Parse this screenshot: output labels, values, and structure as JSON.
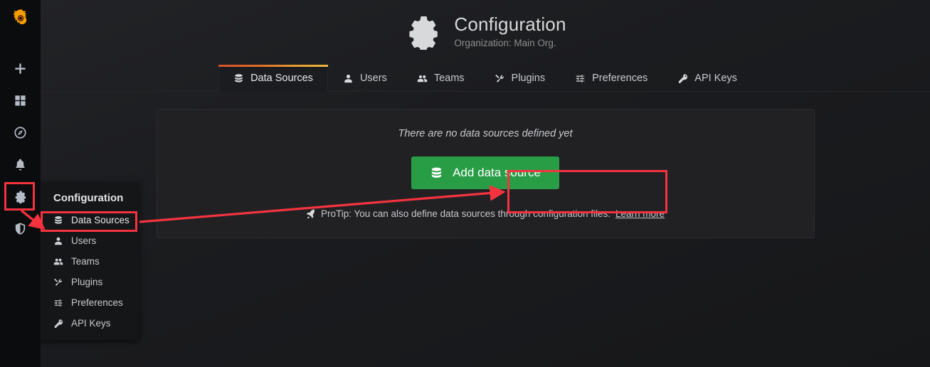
{
  "sidebar": {
    "logo_name": "grafana-logo",
    "items": [
      {
        "name": "create-add",
        "icon": "plus-icon",
        "label": "Create"
      },
      {
        "name": "dashboards",
        "icon": "dashboards-icon",
        "label": "Dashboards"
      },
      {
        "name": "explore",
        "icon": "compass-icon",
        "label": "Explore"
      },
      {
        "name": "alerting",
        "icon": "bell-icon",
        "label": "Alerting"
      },
      {
        "name": "configuration",
        "icon": "gear-icon",
        "label": "Configuration"
      },
      {
        "name": "server-admin",
        "icon": "shield-icon",
        "label": "Server Admin"
      }
    ]
  },
  "header": {
    "icon": "gear-icon",
    "title": "Configuration",
    "subtitle": "Organization: Main Org."
  },
  "tabs": [
    {
      "label": "Data Sources",
      "icon": "database-icon",
      "active": true
    },
    {
      "label": "Users",
      "icon": "user-icon",
      "active": false
    },
    {
      "label": "Teams",
      "icon": "users-icon",
      "active": false
    },
    {
      "label": "Plugins",
      "icon": "plugin-icon",
      "active": false
    },
    {
      "label": "Preferences",
      "icon": "sliders-icon",
      "active": false
    },
    {
      "label": "API Keys",
      "icon": "key-icon",
      "active": false
    }
  ],
  "panel": {
    "empty_message": "There are no data sources defined yet",
    "add_button": {
      "label": "Add data source",
      "icon": "database-icon"
    },
    "protip": {
      "icon": "rocket-icon",
      "text": "ProTip: You can also define data sources through configuration files.",
      "link_label": "Learn more"
    }
  },
  "config_menu": {
    "title": "Configuration",
    "items": [
      {
        "label": "Data Sources",
        "icon": "database-icon",
        "active": true
      },
      {
        "label": "Users",
        "icon": "user-icon",
        "active": false
      },
      {
        "label": "Teams",
        "icon": "users-icon",
        "active": false
      },
      {
        "label": "Plugins",
        "icon": "plugin-icon",
        "active": false
      },
      {
        "label": "Preferences",
        "icon": "sliders-icon",
        "active": false
      },
      {
        "label": "API Keys",
        "icon": "key-icon",
        "active": false
      }
    ]
  },
  "annotations": {
    "highlight_color": "#f5333f",
    "boxes": [
      "sidebar-gear-icon",
      "config-menu-data-sources",
      "add-data-source-button"
    ],
    "arrows": [
      {
        "from": "sidebar-gear-icon",
        "to": "config-menu-data-sources"
      },
      {
        "from": "config-menu-data-sources",
        "to": "add-data-source-button"
      }
    ]
  },
  "colors": {
    "accent_green": "#299c46",
    "tab_gradient_start": "#d8502a",
    "tab_gradient_end": "#eab839",
    "annotation_red": "#f5333f",
    "panel_bg": "#212124"
  }
}
